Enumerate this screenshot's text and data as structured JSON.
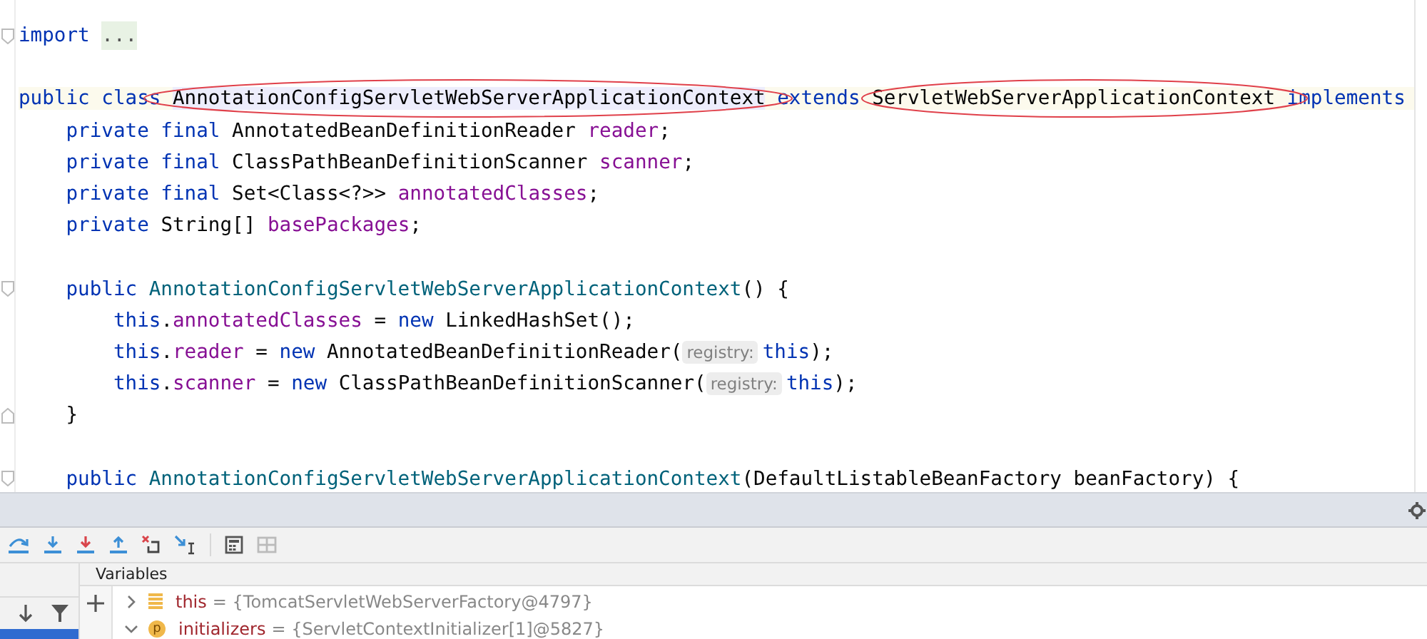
{
  "editor": {
    "lines": [
      {
        "kind": "code",
        "fold_start": true,
        "tokens": [
          {
            "kind": "kw",
            "t": "import "
          },
          {
            "kind": "folded",
            "t": "..."
          }
        ]
      },
      {
        "kind": "blank"
      },
      {
        "kind": "code",
        "current": true,
        "tokens": [
          {
            "kind": "kw",
            "t": "public class "
          },
          {
            "kind": "decl",
            "t": "AnnotationConfigServletWebServerApplicationContext"
          },
          {
            "kind": "kw",
            "t": " extends "
          },
          {
            "kind": "plain",
            "t": "ServletWebServerApplicationContext"
          },
          {
            "kind": "kw",
            "t": " implements"
          }
        ]
      },
      {
        "kind": "code",
        "tokens": [
          {
            "kind": "kw",
            "t": "    private final "
          },
          {
            "kind": "plain",
            "t": "AnnotatedBeanDefinitionReader "
          },
          {
            "kind": "field",
            "t": "reader"
          },
          {
            "kind": "plain",
            "t": ";"
          }
        ]
      },
      {
        "kind": "code",
        "tokens": [
          {
            "kind": "kw",
            "t": "    private final "
          },
          {
            "kind": "plain",
            "t": "ClassPathBeanDefinitionScanner "
          },
          {
            "kind": "field",
            "t": "scanner"
          },
          {
            "kind": "plain",
            "t": ";"
          }
        ]
      },
      {
        "kind": "code",
        "tokens": [
          {
            "kind": "kw",
            "t": "    private final "
          },
          {
            "kind": "plain",
            "t": "Set<Class<?>> "
          },
          {
            "kind": "field",
            "t": "annotatedClasses"
          },
          {
            "kind": "plain",
            "t": ";"
          }
        ]
      },
      {
        "kind": "code",
        "tokens": [
          {
            "kind": "kw",
            "t": "    private "
          },
          {
            "kind": "plain",
            "t": "String[] "
          },
          {
            "kind": "field",
            "t": "basePackages"
          },
          {
            "kind": "plain",
            "t": ";"
          }
        ]
      },
      {
        "kind": "blank"
      },
      {
        "kind": "code",
        "fold_start": true,
        "tokens": [
          {
            "kind": "kw",
            "t": "    public "
          },
          {
            "kind": "method",
            "t": "AnnotationConfigServletWebServerApplicationContext"
          },
          {
            "kind": "plain",
            "t": "() {"
          }
        ]
      },
      {
        "kind": "code",
        "tokens": [
          {
            "kind": "kw",
            "t": "        this"
          },
          {
            "kind": "plain",
            "t": "."
          },
          {
            "kind": "field",
            "t": "annotatedClasses"
          },
          {
            "kind": "plain",
            "t": " = "
          },
          {
            "kind": "kw",
            "t": "new "
          },
          {
            "kind": "plain",
            "t": "LinkedHashSet();"
          }
        ]
      },
      {
        "kind": "code",
        "tokens": [
          {
            "kind": "kw",
            "t": "        this"
          },
          {
            "kind": "plain",
            "t": "."
          },
          {
            "kind": "field",
            "t": "reader"
          },
          {
            "kind": "plain",
            "t": " = "
          },
          {
            "kind": "kw",
            "t": "new "
          },
          {
            "kind": "plain",
            "t": "AnnotatedBeanDefinitionReader("
          },
          {
            "kind": "hint",
            "t": "registry:"
          },
          {
            "kind": "kw",
            "t": "this"
          },
          {
            "kind": "plain",
            "t": ");"
          }
        ]
      },
      {
        "kind": "code",
        "tokens": [
          {
            "kind": "kw",
            "t": "        this"
          },
          {
            "kind": "plain",
            "t": "."
          },
          {
            "kind": "field",
            "t": "scanner"
          },
          {
            "kind": "plain",
            "t": " = "
          },
          {
            "kind": "kw",
            "t": "new "
          },
          {
            "kind": "plain",
            "t": "ClassPathBeanDefinitionScanner("
          },
          {
            "kind": "hint",
            "t": "registry:"
          },
          {
            "kind": "kw",
            "t": "this"
          },
          {
            "kind": "plain",
            "t": ");"
          }
        ]
      },
      {
        "kind": "code",
        "fold_end": true,
        "tokens": [
          {
            "kind": "plain",
            "t": "    }"
          }
        ]
      },
      {
        "kind": "blank"
      },
      {
        "kind": "code",
        "fold_start": true,
        "tokens": [
          {
            "kind": "kw",
            "t": "    public "
          },
          {
            "kind": "method",
            "t": "AnnotationConfigServletWebServerApplicationContext"
          },
          {
            "kind": "plain",
            "t": "(DefaultListableBeanFactory beanFactory) {"
          }
        ]
      }
    ]
  },
  "debugger": {
    "frames": [
      {
        "selected": true
      }
    ],
    "variables_title": "Variables",
    "variables": [
      {
        "kind": "object",
        "expanded": false,
        "name": "this",
        "value": "= {TomcatServletWebServerFactory@4797}"
      },
      {
        "kind": "parameter",
        "badge": "p",
        "expanded": true,
        "name": "initializers",
        "value": "= {ServletContextInitializer[1]@5827}"
      }
    ]
  }
}
